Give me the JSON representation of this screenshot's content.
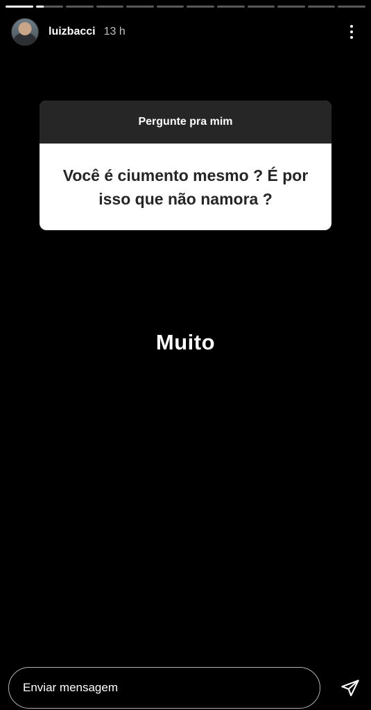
{
  "progress": {
    "segments": 12,
    "current_index": 1,
    "current_fraction": 0.3
  },
  "header": {
    "username": "luizbacci",
    "time": "13 h",
    "more_icon": "more-vertical-icon"
  },
  "question_sticker": {
    "title": "Pergunte pra mim",
    "question": "Você é ciumento mesmo ? É por isso que não namora ?"
  },
  "answer": "Muito",
  "footer": {
    "message_placeholder": "Enviar mensagem",
    "send_icon": "send-icon"
  }
}
